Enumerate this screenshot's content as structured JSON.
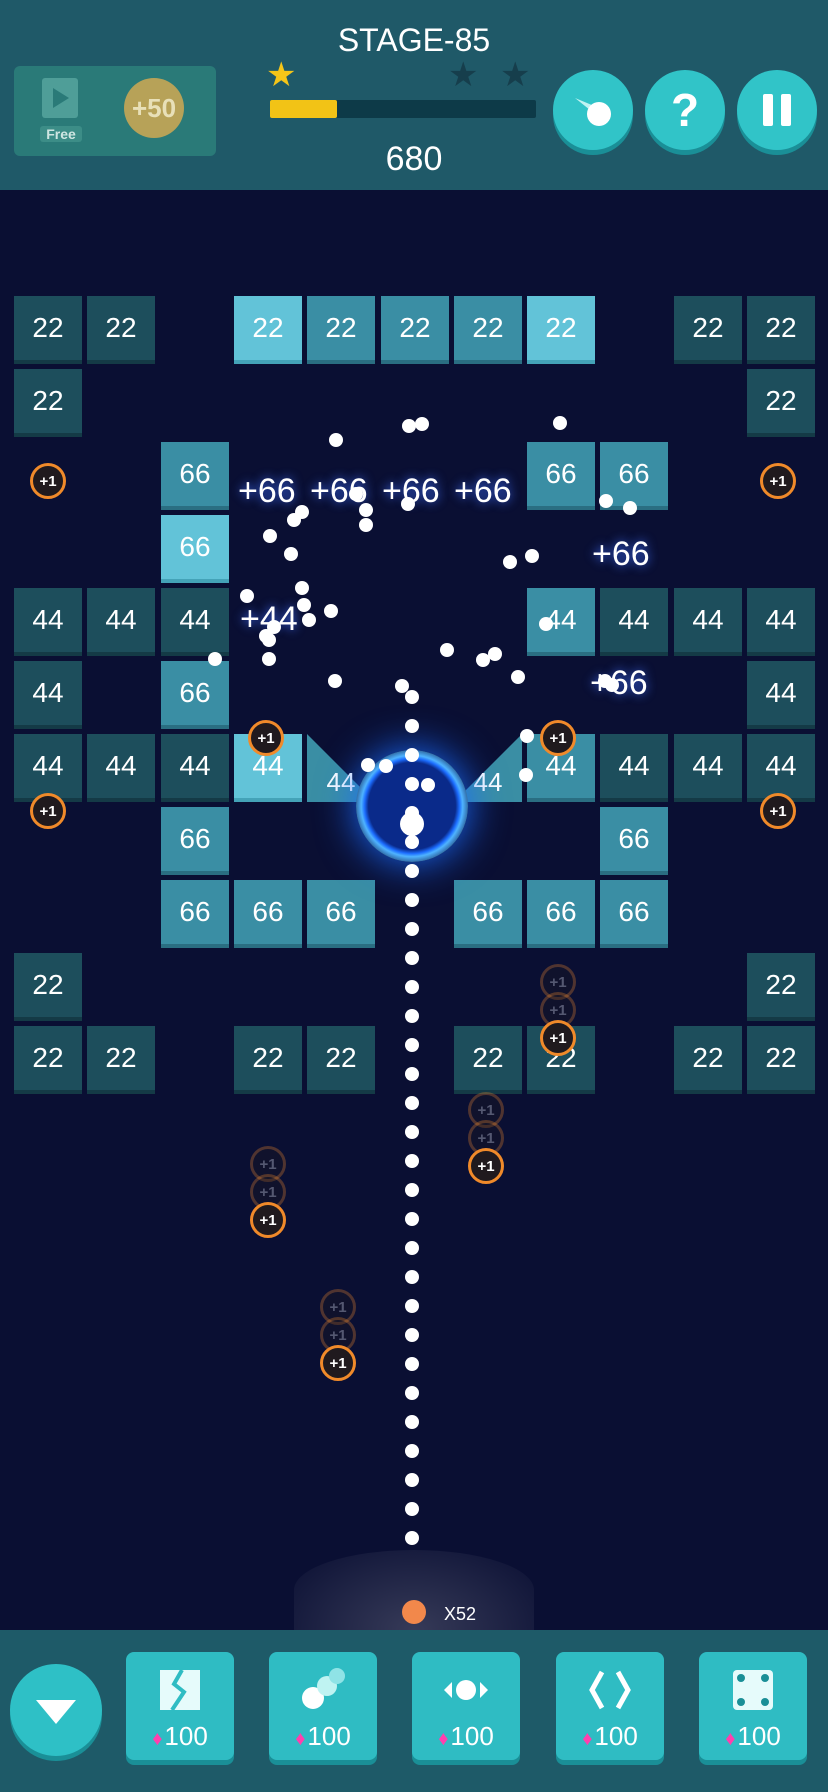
{
  "header": {
    "stage_title": "STAGE-85",
    "score": "680",
    "stars_earned": 1,
    "stars_total": 3,
    "progress": 0.25,
    "ad": {
      "free_label": "Free",
      "coin_reward": "+50"
    },
    "buttons": {
      "help_label": "?"
    }
  },
  "board": {
    "bricks": [
      {
        "v": "22",
        "c": "dark"
      },
      {
        "v": "22",
        "c": "dark"
      },
      {
        "v": "22",
        "c": "light"
      },
      {
        "v": "22",
        "c": "mid"
      },
      {
        "v": "22",
        "c": "mid"
      },
      {
        "v": "22",
        "c": "mid"
      },
      {
        "v": "22",
        "c": "light"
      },
      {
        "v": "22",
        "c": "dark"
      },
      {
        "v": "22",
        "c": "dark"
      },
      {
        "v": "22",
        "c": "dark"
      },
      {
        "v": "22",
        "c": "dark"
      },
      {
        "v": "66",
        "c": "mid"
      },
      {
        "v": "66",
        "c": "mid"
      },
      {
        "v": "66",
        "c": "mid"
      },
      {
        "v": "66",
        "c": "light"
      },
      {
        "v": "44",
        "c": "dark"
      },
      {
        "v": "44",
        "c": "dark"
      },
      {
        "v": "44",
        "c": "dark"
      },
      {
        "v": "44",
        "c": "mid"
      },
      {
        "v": "44",
        "c": "dark"
      },
      {
        "v": "44",
        "c": "dark"
      },
      {
        "v": "44",
        "c": "dark"
      },
      {
        "v": "44",
        "c": "dark"
      },
      {
        "v": "66",
        "c": "mid"
      },
      {
        "v": "44",
        "c": "dark"
      },
      {
        "v": "44",
        "c": "dark"
      },
      {
        "v": "44",
        "c": "dark"
      },
      {
        "v": "44",
        "c": "dark"
      },
      {
        "v": "44",
        "c": "light"
      },
      {
        "v": "44",
        "c": "mid"
      },
      {
        "v": "44",
        "c": "dark"
      },
      {
        "v": "44",
        "c": "dark"
      },
      {
        "v": "44",
        "c": "dark"
      },
      {
        "v": "66",
        "c": "mid"
      },
      {
        "v": "66",
        "c": "mid"
      },
      {
        "v": "66",
        "c": "mid"
      },
      {
        "v": "66",
        "c": "mid"
      },
      {
        "v": "66",
        "c": "mid"
      },
      {
        "v": "66",
        "c": "mid"
      },
      {
        "v": "66",
        "c": "mid"
      },
      {
        "v": "66",
        "c": "mid"
      },
      {
        "v": "22",
        "c": "dark"
      },
      {
        "v": "22",
        "c": "dark"
      },
      {
        "v": "22",
        "c": "dark"
      },
      {
        "v": "22",
        "c": "dark"
      },
      {
        "v": "22",
        "c": "dark"
      },
      {
        "v": "22",
        "c": "dark"
      },
      {
        "v": "22",
        "c": "dark"
      },
      {
        "v": "22",
        "c": "dark"
      },
      {
        "v": "22",
        "c": "dark"
      },
      {
        "v": "22",
        "c": "dark"
      }
    ],
    "triangles": [
      {
        "v": "44",
        "dir": "left"
      },
      {
        "v": "44",
        "dir": "right"
      }
    ],
    "floating_texts": [
      "+66",
      "+66",
      "+66",
      "+66",
      "+66",
      "+44",
      "+66"
    ],
    "plus_pickup_label": "+1",
    "plus_pickups": 6,
    "falling_pickups": 4,
    "aim_dots": 30,
    "scatter_balls": 40
  },
  "launcher": {
    "ball_count": "X52"
  },
  "toolbar": {
    "tools": [
      {
        "icon": "crack-brick-icon",
        "price": "100"
      },
      {
        "icon": "multi-ball-icon",
        "price": "100"
      },
      {
        "icon": "horizontal-ball-icon",
        "price": "100"
      },
      {
        "icon": "side-walls-icon",
        "price": "100"
      },
      {
        "icon": "dice-icon",
        "price": "100"
      }
    ]
  },
  "colors": {
    "background": "#0a0f33",
    "header": "#1f5968",
    "accent": "#31c4c8",
    "gem": "#ff3fae",
    "star": "#f5c518",
    "pickup_ring": "#f08a2a"
  }
}
